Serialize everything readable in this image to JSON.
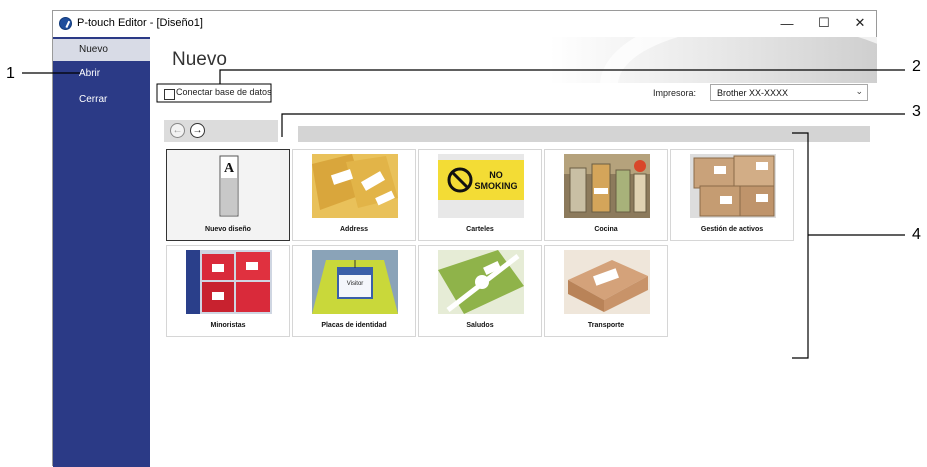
{
  "window": {
    "title": "P-touch Editor - [Diseño1]"
  },
  "sidebar": {
    "items": [
      {
        "label": "Nuevo",
        "active": true
      },
      {
        "label": "Abrir",
        "active": false
      },
      {
        "label": "Cerrar",
        "active": false
      }
    ]
  },
  "main": {
    "title": "Nuevo",
    "connect_db_label": "Conectar base de datos",
    "printer_label": "Impresora:",
    "printer_value": "Brother XX-XXXX"
  },
  "templates": [
    {
      "label": "Nuevo diseño",
      "icon": "blank-label-icon",
      "selected": true
    },
    {
      "label": "Address",
      "icon": "address-labels-photo"
    },
    {
      "label": "Carteles",
      "icon": "no-smoking-sign-photo"
    },
    {
      "label": "Cocina",
      "icon": "kitchen-jars-photo"
    },
    {
      "label": "Gestión de activos",
      "icon": "asset-boxes-photo"
    },
    {
      "label": "Minoristas",
      "icon": "retail-boxes-photo"
    },
    {
      "label": "Placas de identidad",
      "icon": "id-badge-photo"
    },
    {
      "label": "Saludos",
      "icon": "gift-ribbon-photo"
    },
    {
      "label": "Transporte",
      "icon": "shipping-box-photo"
    }
  ],
  "tile_images": {
    "no_smoking_line1": "NO",
    "no_smoking_line2": "SMOKING",
    "badge_visitor": "Visitor",
    "blank_glyph": "A"
  },
  "annotations": {
    "n1": "1",
    "n2": "2",
    "n3": "3",
    "n4": "4"
  }
}
